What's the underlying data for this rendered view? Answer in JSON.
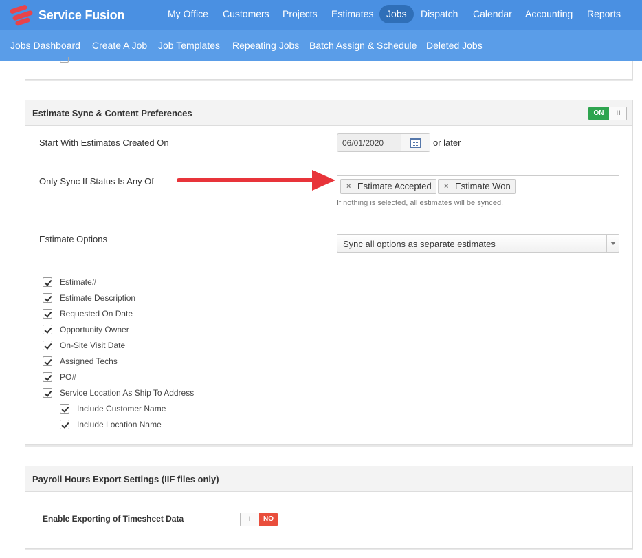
{
  "app": {
    "name": "Service Fusion"
  },
  "main_nav": [
    {
      "label": "My Office",
      "active": false
    },
    {
      "label": "Customers",
      "active": false
    },
    {
      "label": "Projects",
      "active": false
    },
    {
      "label": "Estimates",
      "active": false
    },
    {
      "label": "Jobs",
      "active": true
    },
    {
      "label": "Dispatch",
      "active": false
    },
    {
      "label": "Calendar",
      "active": false
    },
    {
      "label": "Accounting",
      "active": false
    },
    {
      "label": "Reports",
      "active": false
    }
  ],
  "sub_nav": [
    {
      "label": "Jobs Dashboard",
      "active": true
    },
    {
      "label": "Create A Job",
      "active": false
    },
    {
      "label": "Job Templates",
      "active": false
    },
    {
      "label": "Repeating Jobs",
      "active": false
    },
    {
      "label": "Batch Assign & Schedule",
      "active": false
    },
    {
      "label": "Deleted Jobs",
      "active": false
    }
  ],
  "estimate_sync": {
    "title": "Estimate Sync & Content Preferences",
    "toggle_label": "ON",
    "toggle_grip": "III",
    "start_label": "Start With Estimates Created On",
    "start_date": "06/01/2020",
    "or_later": "or later",
    "status_label": "Only Sync If Status Is Any Of",
    "status_tags": [
      "Estimate Accepted",
      "Estimate Won"
    ],
    "tag_remove_glyph": "×",
    "status_hint": "If nothing is selected, all estimates will be synced.",
    "options_label": "Estimate Options",
    "options_value": "Sync all options as separate estimates",
    "checkboxes": [
      {
        "label": "Estimate#",
        "checked": true,
        "nested": false
      },
      {
        "label": "Estimate Description",
        "checked": true,
        "nested": false
      },
      {
        "label": "Requested On Date",
        "checked": true,
        "nested": false
      },
      {
        "label": "Opportunity Owner",
        "checked": true,
        "nested": false
      },
      {
        "label": "On-Site Visit Date",
        "checked": true,
        "nested": false
      },
      {
        "label": "Assigned Techs",
        "checked": true,
        "nested": false
      },
      {
        "label": "PO#",
        "checked": true,
        "nested": false
      },
      {
        "label": "Service Location As Ship To Address",
        "checked": true,
        "nested": false
      },
      {
        "label": "Include Customer Name",
        "checked": true,
        "nested": true
      },
      {
        "label": "Include Location Name",
        "checked": true,
        "nested": true
      }
    ]
  },
  "payroll": {
    "title": "Payroll Hours Export Settings (IIF files only)",
    "enable_label": "Enable Exporting of Timesheet Data",
    "toggle_label": "NO",
    "toggle_grip": "III"
  },
  "colors": {
    "nav_bg": "#4a90e2",
    "subnav_bg": "#5a9de8",
    "on_green": "#2ea44f",
    "off_red": "#e94e3c",
    "annotation_arrow": "#e8343a"
  }
}
